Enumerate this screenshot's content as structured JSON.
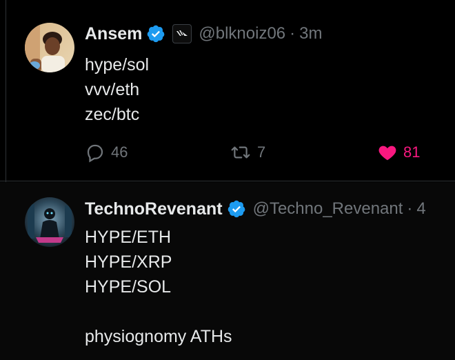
{
  "tweets": [
    {
      "name": "Ansem",
      "handle": "@blknoiz06",
      "separator": "·",
      "time": "3m",
      "lines": [
        "hype/sol",
        "vvv/eth",
        "zec/btc"
      ],
      "replies": "46",
      "reposts": "7",
      "likes": "81",
      "liked": true,
      "verified": true,
      "affiliate_icon": "wings-badge-icon"
    },
    {
      "name": "TechnoRevenant",
      "handle": "@Techno_Revenant",
      "separator": "·",
      "time": "4",
      "lines": [
        "HYPE/ETH",
        "HYPE/XRP",
        "HYPE/SOL",
        "",
        "physiognomy ATHs"
      ],
      "verified": true
    }
  ],
  "colors": {
    "background": "#000000",
    "text": "#e7e9ea",
    "muted": "#71767b",
    "verified": "#1d9bf0",
    "like": "#f91880",
    "divider": "#2f3336"
  }
}
